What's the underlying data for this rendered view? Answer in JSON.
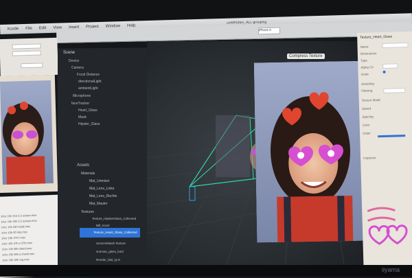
{
  "window_title": "unARKitten_ALL-grouping",
  "menu": [
    "Xcode",
    "File",
    "Edit",
    "View",
    "Insert",
    "Project",
    "Window",
    "Help"
  ],
  "device_label": "iPhone 8",
  "scene": {
    "header": "Scene",
    "items": [
      "Device",
      "Camera",
      "Focal Distance",
      "directionalLight",
      "ambientLight",
      "Microphone",
      "faceTracker",
      "Heart_Glass",
      "Mask",
      "Hipster_Glass"
    ]
  },
  "assets": {
    "header": "Assets",
    "items": [
      "Materials",
      "Mat_Unmixer",
      "Mat_Lens_Links",
      "Mat_Lens_Rechts",
      "Mat_Mauler",
      "Textures",
      "Texture_HipsterGlass_Collected",
      "Bill_Icon2",
      "Texture_Heart_Glass_Collected",
      "Scence/Mask Texture",
      "sunmax_glass_bot2",
      "Render_fast_Q-S"
    ]
  },
  "fps_label": "Compress Texture",
  "inspector": {
    "title": "Texture_Heart_Glass",
    "labels": [
      "Name",
      "Dimensions",
      "Type",
      "Alpha Ch",
      "Scale",
      "Sampling",
      "Filtering",
      "Texture Mode",
      "Speed",
      "Spacing",
      "Color",
      "Order",
      "Inspector"
    ]
  },
  "finder_files": [
    "1Hzr 10h 31h 2.2 screen.mov",
    "1Hzr 10h 33h 2.2 screen.mov",
    "1Hzr 10h 34h hcad.mov",
    "1Hzr 10h 30 tmp.mov",
    "1Hzr 10h 37h f.mov",
    "1Hzr 10h 37h a 37hi.mov",
    "1Hzr 10h 38h sherd.mov",
    "1Hzr 10h 38h a cherd.mov",
    "1Hzr 10h 40h reg.mov"
  ],
  "brand": "iiyama"
}
